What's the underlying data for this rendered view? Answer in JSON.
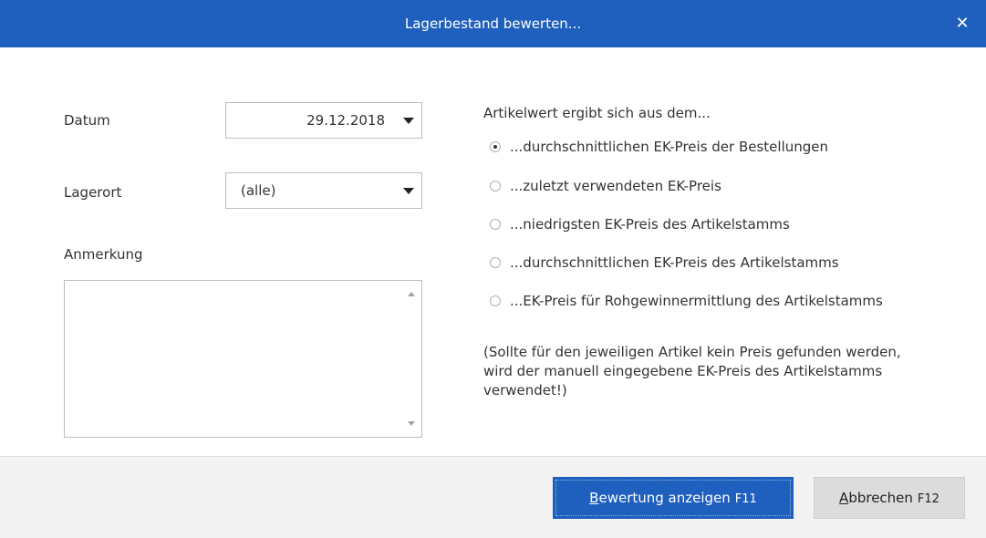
{
  "window": {
    "title": "Lagerbestand bewerten...",
    "close_glyph": "✕"
  },
  "form": {
    "datum_label": "Datum",
    "datum_value": "29.12.2018",
    "lagerort_label": "Lagerort",
    "lagerort_value": "(alle)",
    "anmerkung_label": "Anmerkung",
    "anmerkung_value": ""
  },
  "valuation": {
    "heading": "Artikelwert ergibt sich aus dem...",
    "options": [
      {
        "label": "...durchschnittlichen EK-Preis der Bestellungen",
        "selected": true
      },
      {
        "label": "...zuletzt verwendeten EK-Preis",
        "selected": false
      },
      {
        "label": "...niedrigsten EK-Preis des Artikelstamms",
        "selected": false
      },
      {
        "label": "...durchschnittlichen EK-Preis des Artikelstamms",
        "selected": false
      },
      {
        "label": "...EK-Preis für Rohgewinnermittlung des Artikelstamms",
        "selected": false
      }
    ],
    "note": "(Sollte für den jeweiligen Artikel kein Preis gefunden werden, wird der manuell eingegebene EK-Preis des Artikelstamms verwendet!)"
  },
  "footer": {
    "primary_mnemonic": "B",
    "primary_label_rest": "ewertung anzeigen",
    "primary_key": "F11",
    "cancel_mnemonic": "A",
    "cancel_label_rest": "bbrechen",
    "cancel_key": "F12"
  },
  "colors": {
    "accent": "#1f5fbd",
    "footer_bg": "#f2f2f2",
    "secondary_button": "#dcdcdc"
  }
}
